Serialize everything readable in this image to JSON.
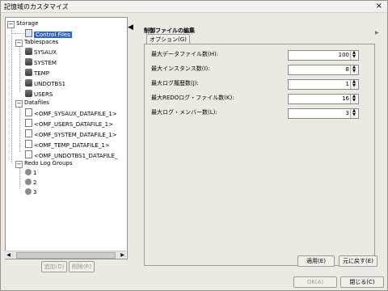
{
  "window": {
    "title": "記憶域のカスタマイズ",
    "close_symbol": "×"
  },
  "tree": {
    "storage": "Storage",
    "control_files": "Control Files",
    "tablespaces_label": "Tablespaces",
    "tablespaces": [
      "SYSAUX",
      "SYSTEM",
      "TEMP",
      "UNDOTBS1",
      "USERS"
    ],
    "datafiles_label": "Datafiles",
    "datafiles": [
      "<OMF_SYSAUX_DATAFILE_1>",
      "<OMF_USERS_DATAFILE_1>",
      "<OMF_SYSTEM_DATAFILE_1>",
      "<OMF_TEMP_DATAFILE_1>",
      "<OMF_UNDOTBS1_DATAFILE_"
    ],
    "redo_label": "Redo Log Groups",
    "redo_groups": [
      "1",
      "2",
      "3"
    ]
  },
  "left_buttons": {
    "add": "追加(D)",
    "remove": "削除(R)"
  },
  "panel": {
    "header": "制御ファイルの編集",
    "tab": "オプション(G)",
    "params": [
      {
        "label": "最大データファイル数(H):",
        "value": "100"
      },
      {
        "label": "最大インスタンス数(I):",
        "value": "8"
      },
      {
        "label": "最大ログ履歴数(J):",
        "value": "1"
      },
      {
        "label": "最大REDOログ・ファイル数(K):",
        "value": "16"
      },
      {
        "label": "最大ログ・メンバー数(L):",
        "value": "3"
      }
    ],
    "apply": "適用(E)",
    "revert": "元に戻す(E)"
  },
  "footer": {
    "ok": "OK(A)",
    "close": "閉じる(C)"
  }
}
